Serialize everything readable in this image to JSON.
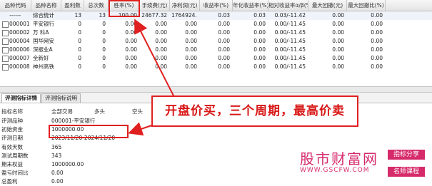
{
  "grid": {
    "columns": [
      "品种代码",
      "品种名称",
      "盈利数",
      "总次数",
      "胜率(%)",
      "手续费(元)",
      "净利润(元)",
      "收益率(%)",
      "年化收益率(%)",
      "相对收益率α/β(%)",
      "最大回撤(元)",
      "最大回撤比(%)"
    ],
    "rows": [
      {
        "code": "------",
        "name": "综合统计",
        "wins": "13",
        "total": "13",
        "winrate": "100.00",
        "fee": "24677.32",
        "profit": "1764924....",
        "ret": "0.03",
        "annual": "0.03",
        "alpha": "0.03/-11.42",
        "maxdd": "0.00",
        "ddratio": "0.00",
        "checkbox": false
      },
      {
        "code": "000001",
        "name": "平安银行",
        "wins": "0",
        "total": "0",
        "winrate": "0.00",
        "fee": "0.00",
        "profit": "0.00",
        "ret": "0.00",
        "annual": "0.00",
        "alpha": "0.00/-11.45",
        "maxdd": "0.00",
        "ddratio": "0.00",
        "checkbox": true
      },
      {
        "code": "000002",
        "name": "万 科A",
        "wins": "0",
        "total": "0",
        "winrate": "0.00",
        "fee": "0.00",
        "profit": "0.00",
        "ret": "0.00",
        "annual": "0.00",
        "alpha": "0.00/-11.45",
        "maxdd": "0.00",
        "ddratio": "0.00",
        "checkbox": true
      },
      {
        "code": "000004",
        "name": "国华网安",
        "wins": "0",
        "total": "0",
        "winrate": "0.00",
        "fee": "0.00",
        "profit": "0.00",
        "ret": "0.00",
        "annual": "0.00",
        "alpha": "0.00/-11.45",
        "maxdd": "0.00",
        "ddratio": "0.00",
        "checkbox": true
      },
      {
        "code": "000006",
        "name": "深振业A",
        "wins": "0",
        "total": "0",
        "winrate": "0.00",
        "fee": "0.00",
        "profit": "0.00",
        "ret": "0.00",
        "annual": "0.00",
        "alpha": "0.00/-11.45",
        "maxdd": "0.00",
        "ddratio": "0.00",
        "checkbox": true
      },
      {
        "code": "000007",
        "name": "全新好",
        "wins": "0",
        "total": "0",
        "winrate": "0.00",
        "fee": "0.00",
        "profit": "0.00",
        "ret": "0.00",
        "annual": "0.00",
        "alpha": "0.00/-11.45",
        "maxdd": "0.00",
        "ddratio": "0.00",
        "checkbox": true
      },
      {
        "code": "000008",
        "name": "神州高铁",
        "wins": "0",
        "total": "0",
        "winrate": "0.00",
        "fee": "0.00",
        "profit": "0.00",
        "ret": "0.00",
        "annual": "0.00",
        "alpha": "0.00/-11.45",
        "maxdd": "0.00",
        "ddratio": "0.00",
        "checkbox": true
      }
    ]
  },
  "tabs": [
    "评测指标详情",
    "评测指标说明"
  ],
  "detail": {
    "headers": [
      "指标名称",
      "全部交易",
      "多头",
      "空头"
    ],
    "rows": [
      {
        "label": "评测品种",
        "value": "000001-平安银行"
      },
      {
        "label": "初始资金",
        "value": "1000000.00"
      },
      {
        "label": "评测日期",
        "value": "2023/11/20-2024/11/20"
      },
      {
        "label": "有效天数",
        "value": "365"
      },
      {
        "label": "测试周期数",
        "value": "343"
      },
      {
        "label": "期末权益",
        "value": "1000000.00"
      },
      {
        "label": "盈亏时间比",
        "value": "0.00"
      },
      {
        "label": "总盈利",
        "value": "0.00"
      }
    ]
  },
  "annotation": {
    "text": "开盘价买，三个周期，最高价卖",
    "color": "#e02020"
  },
  "watermark": {
    "title": "股市财富网",
    "url": "WWW.GSCFW.COM",
    "badge1": "指标分享",
    "badge2": "名师课程",
    "color": "#d62b6b"
  }
}
